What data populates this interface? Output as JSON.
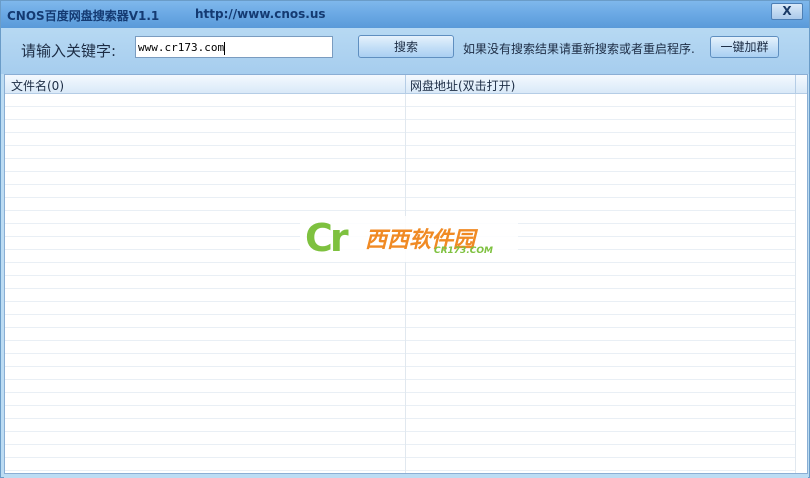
{
  "window": {
    "title": "CNOS百度网盘搜索器V1.1",
    "url": "http://www.cnos.us",
    "close_label": "X"
  },
  "toolbar": {
    "keyword_label": "请输入关键字:",
    "keyword_value": "www.cr173.com",
    "search_label": "搜索",
    "hint": "如果没有搜索结果请重新搜索或者重启程序.",
    "group_label": "一键加群"
  },
  "list": {
    "columns": [
      "文件名(0)",
      "网盘地址(双击打开)"
    ]
  },
  "watermark": {
    "letters": "Cr",
    "brand_cn": "西西软件园",
    "brand_en": "CR173.COM"
  }
}
